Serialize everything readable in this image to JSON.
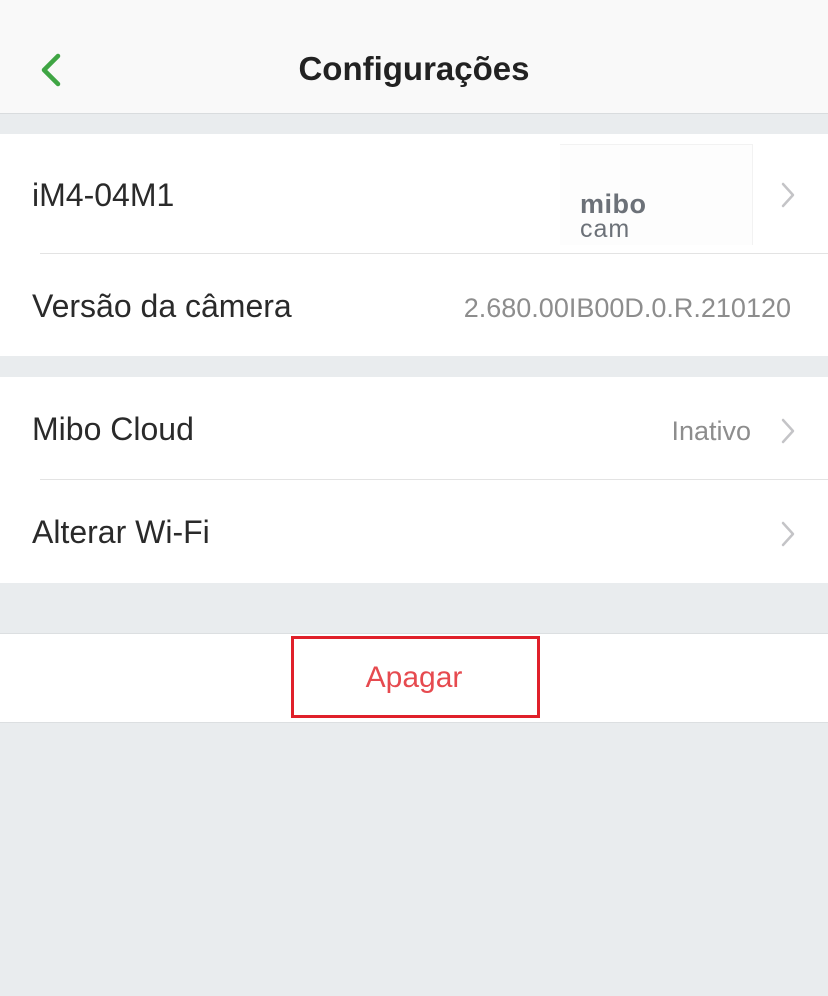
{
  "header": {
    "title": "Configurações",
    "back_icon": "chevron-left-icon",
    "accent_color": "#3fa544"
  },
  "device": {
    "name": "iM4-04M1",
    "thumbnail_brand_top": "mibo",
    "thumbnail_brand_bottom": "cam",
    "version_label": "Versão da câmera",
    "version_value": "2.680.00IB00D.0.R.210120"
  },
  "services": {
    "cloud_label": "Mibo Cloud",
    "cloud_status": "Inativo",
    "wifi_label": "Alterar Wi-Fi"
  },
  "actions": {
    "delete_label": "Apagar",
    "delete_color": "#e64a4f",
    "highlight_color": "#e0202a"
  }
}
